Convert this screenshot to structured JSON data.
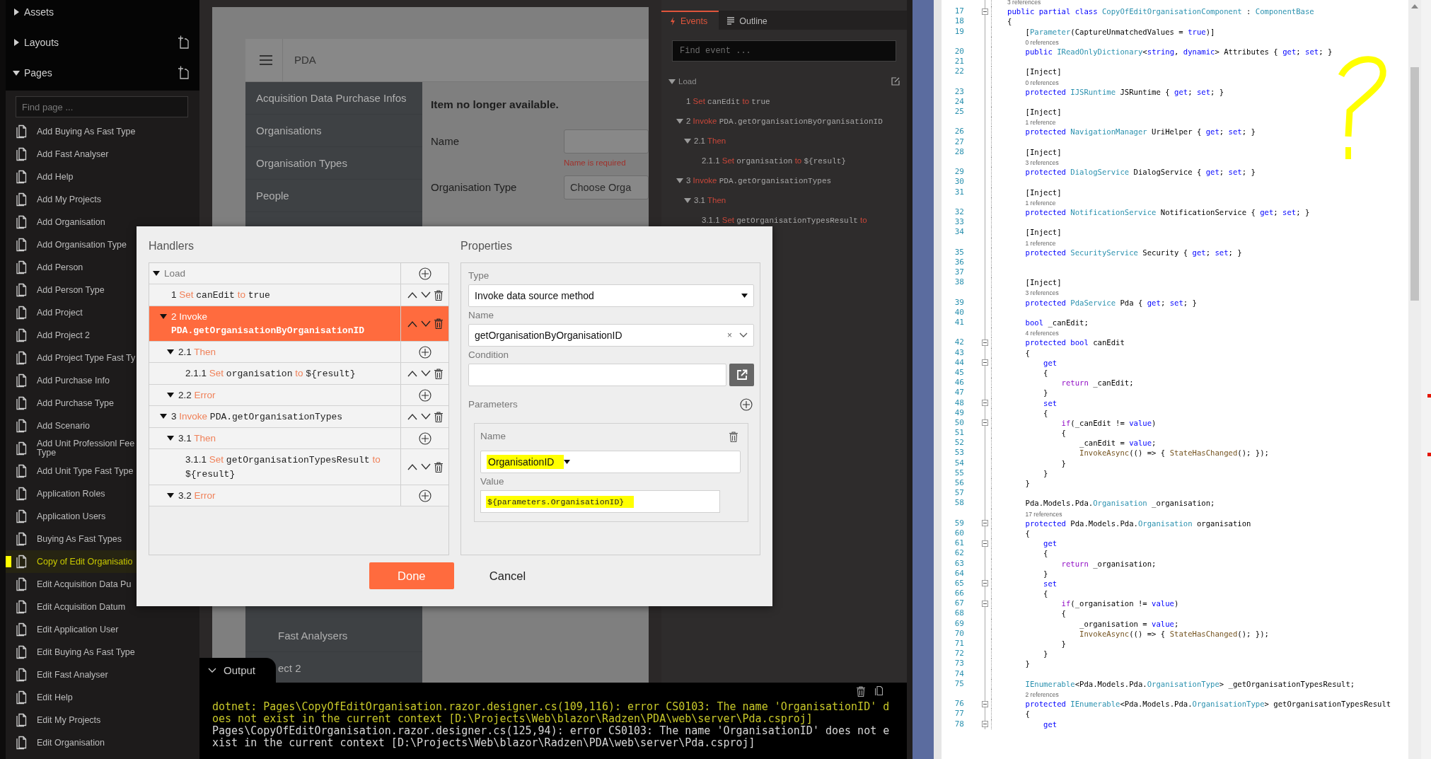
{
  "sidebar": {
    "sections": [
      {
        "label": "Assets",
        "expanded": false,
        "add_button": false
      },
      {
        "label": "Layouts",
        "expanded": false,
        "add_button": true
      },
      {
        "label": "Pages",
        "expanded": true,
        "add_button": true
      }
    ],
    "search": {
      "placeholder": "Find page ..."
    },
    "pages": [
      {
        "label": "Add Buying As Fast Type",
        "highlighted": false
      },
      {
        "label": "Add Fast Analyser",
        "highlighted": false
      },
      {
        "label": "Add Help",
        "highlighted": false
      },
      {
        "label": "Add My Projects",
        "highlighted": false
      },
      {
        "label": "Add Organisation",
        "highlighted": false
      },
      {
        "label": "Add Organisation Type",
        "highlighted": false
      },
      {
        "label": "Add Person",
        "highlighted": false
      },
      {
        "label": "Add Person Type",
        "highlighted": false
      },
      {
        "label": "Add Project",
        "highlighted": false
      },
      {
        "label": "Add Project 2",
        "highlighted": false
      },
      {
        "label": "Add Project Type Fast Ty",
        "highlighted": false
      },
      {
        "label": "Add Purchase Info",
        "highlighted": false
      },
      {
        "label": "Add Purchase Type",
        "highlighted": false
      },
      {
        "label": "Add Scenario",
        "highlighted": false
      },
      {
        "label": "Add Unit Professionl Fee Type",
        "highlighted": false
      },
      {
        "label": "Add Unit Type Fast Type",
        "highlighted": false
      },
      {
        "label": "Application Roles",
        "highlighted": false
      },
      {
        "label": "Application Users",
        "highlighted": false
      },
      {
        "label": "Buying As Fast Types",
        "highlighted": false
      },
      {
        "label": "Copy of Edit Organisatio",
        "highlighted": true
      },
      {
        "label": "Edit Acquisition Data Pu",
        "highlighted": false
      },
      {
        "label": "Edit Acquisition Datum",
        "highlighted": false
      },
      {
        "label": "Edit Application User",
        "highlighted": false
      },
      {
        "label": "Edit Buying As Fast Type",
        "highlighted": false
      },
      {
        "label": "Edit Fast Analyser",
        "highlighted": false
      },
      {
        "label": "Edit Help",
        "highlighted": false
      },
      {
        "label": "Edit My Projects",
        "highlighted": false
      },
      {
        "label": "Edit Organisation",
        "highlighted": false
      }
    ]
  },
  "designer": {
    "app_title": "PDA",
    "nav_items": [
      "Acquisition Data Purchase Infos",
      "Organisations",
      "Organisation Types",
      "People"
    ],
    "nav_items_lower": [
      "Fast Analysers",
      "ect 2"
    ],
    "form": {
      "notice": "Item no longer available.",
      "fields": [
        {
          "label": "Name",
          "kind": "text",
          "error": "Name is required"
        },
        {
          "label": "Organisation Type",
          "kind": "dropdown",
          "placeholder": "Choose Orga"
        }
      ]
    }
  },
  "events_panel": {
    "tabs": [
      {
        "label": "Events",
        "selected": true
      },
      {
        "label": "Outline",
        "selected": false
      }
    ],
    "search": {
      "placeholder": "Find event ..."
    },
    "tree": {
      "label": "Load",
      "expanded": true,
      "children": [
        {
          "number": "1",
          "verb": "Set",
          "target": "canEdit",
          "link": "to",
          "value": "true"
        },
        {
          "number": "2",
          "verb": "Invoke",
          "target": "PDA.getOrganisationByOrganisationID",
          "expanded": true,
          "children": [
            {
              "number": "2.1",
              "verb": "Then",
              "expanded": true,
              "children": [
                {
                  "number": "2.1.1",
                  "verb": "Set",
                  "target": "organisation",
                  "link": "to",
                  "value": "${result}"
                }
              ]
            }
          ]
        },
        {
          "number": "3",
          "verb": "Invoke",
          "target": "PDA.getOrganisationTypes",
          "expanded": true,
          "children": [
            {
              "number": "3.1",
              "verb": "Then",
              "expanded": true,
              "children": [
                {
                  "number": "3.1.1",
                  "verb": "Set",
                  "target": "getOrganisationTypesResult",
                  "link": "to"
                }
              ]
            }
          ]
        }
      ]
    }
  },
  "dialog": {
    "handlers_title": "Handlers",
    "properties_title": "Properties",
    "handlers": {
      "label": "Load",
      "kind": "group",
      "expanded": true,
      "selected": false,
      "children": [
        {
          "number": "1",
          "verb": "Set",
          "target": "canEdit",
          "link": "to",
          "value": "true",
          "kind": "action",
          "selected": false
        },
        {
          "number": "2",
          "verb": "Invoke",
          "target": "PDA.getOrganisationByOrganisationID",
          "kind": "action",
          "expanded": true,
          "selected": true,
          "children": [
            {
              "number": "2.1",
              "verb": "Then",
              "kind": "group",
              "expanded": true,
              "selected": false,
              "children": [
                {
                  "number": "2.1.1",
                  "verb": "Set",
                  "target": "organisation",
                  "link": "to",
                  "value": "${result}",
                  "kind": "action",
                  "selected": false
                }
              ]
            },
            {
              "number": "2.2",
              "verb": "Error",
              "kind": "group",
              "expanded": true,
              "selected": false
            }
          ]
        },
        {
          "number": "3",
          "verb": "Invoke",
          "target": "PDA.getOrganisationTypes",
          "kind": "action",
          "expanded": true,
          "selected": false,
          "children": [
            {
              "number": "3.1",
              "verb": "Then",
              "kind": "group",
              "expanded": true,
              "selected": false,
              "children": [
                {
                  "number": "3.1.1",
                  "verb": "Set",
                  "target": "getOrganisationTypesResult",
                  "link": "to",
                  "value": "${result}",
                  "kind": "action",
                  "selected": false
                }
              ]
            },
            {
              "number": "3.2",
              "verb": "Error",
              "kind": "group",
              "expanded": true,
              "selected": false
            }
          ]
        }
      ]
    },
    "properties": [
      {
        "label": "Type",
        "kind": "select",
        "value": "Invoke data source method"
      },
      {
        "label": "Name",
        "kind": "combo",
        "value": "getOrganisationByOrganisationID",
        "clear": "×"
      },
      {
        "label": "Condition",
        "kind": "expression"
      }
    ],
    "parameters": {
      "label": "Parameters",
      "items": [
        {
          "name_label": "Name",
          "name": "OrganisationID",
          "name_highlighted": true,
          "value_label": "Value",
          "value": "${parameters.OrganisationID}",
          "value_highlighted": true
        }
      ]
    },
    "buttons": [
      {
        "label": "Done",
        "kind": "primary"
      },
      {
        "label": "Cancel",
        "kind": "plain"
      }
    ]
  },
  "output": {
    "title": "Output",
    "messages": [
      {
        "kind": "highlight",
        "text": "dotnet: Pages\\CopyOfEditOrganisation.razor.designer.cs(109,116): error CS0103: The name 'OrganisationID' does not exist in the current context [D:\\Projects\\Web\\blazor\\Radzen\\PDA\\web\\server\\Pda.csproj]"
      },
      {
        "kind": "normal",
        "text": "Pages\\CopyOfEditOrganisation.razor.designer.cs(125,94): error CS0103: The name 'OrganisationID' does not exist in the current context [D:\\Projects\\Web\\blazor\\Radzen\\PDA\\web\\server\\Pda.csproj]"
      }
    ]
  },
  "code_editor": {
    "lines": [
      {
        "kind": "codelens",
        "text": "3 references"
      },
      {
        "kind": "code",
        "number": "17",
        "fold": true,
        "tokens": [
          {
            "kind": "keyword",
            "text": "public partial class "
          },
          {
            "kind": "type",
            "text": "CopyOfEditOrganisationComponent"
          },
          {
            "kind": "plain",
            "text": " : "
          },
          {
            "kind": "type",
            "text": "ComponentBase"
          }
        ]
      },
      {
        "kind": "code",
        "number": "18",
        "fold": false,
        "tokens": [
          {
            "kind": "plain",
            "text": "{"
          }
        ]
      },
      {
        "kind": "code",
        "number": "19",
        "fold": false,
        "tokens": [
          {
            "kind": "plain",
            "text": "    ["
          },
          {
            "kind": "type",
            "text": "Parameter"
          },
          {
            "kind": "plain",
            "text": "(CaptureUnmatchedValues = "
          },
          {
            "kind": "keyword",
            "text": "true"
          },
          {
            "kind": "plain",
            "text": ")]"
          }
        ]
      },
      {
        "kind": "codelens",
        "text": "    0 references"
      },
      {
        "kind": "code",
        "number": "20",
        "fold": false,
        "tokens": [
          {
            "kind": "keyword",
            "text": "    public "
          },
          {
            "kind": "type",
            "text": "IReadOnlyDictionary"
          },
          {
            "kind": "plain",
            "text": "<"
          },
          {
            "kind": "keyword",
            "text": "string"
          },
          {
            "kind": "plain",
            "text": ", "
          },
          {
            "kind": "keyword",
            "text": "dynamic"
          },
          {
            "kind": "plain",
            "text": "> Attributes { "
          },
          {
            "kind": "keyword",
            "text": "get"
          },
          {
            "kind": "plain",
            "text": "; "
          },
          {
            "kind": "keyword",
            "text": "set"
          },
          {
            "kind": "plain",
            "text": "; }"
          }
        ]
      },
      {
        "kind": "code",
        "number": "21",
        "fold": false
      },
      {
        "kind": "code",
        "number": "22",
        "fold": false,
        "tokens": [
          {
            "kind": "plain",
            "text": "    [Inject]"
          }
        ]
      },
      {
        "kind": "codelens",
        "text": "    0 references"
      },
      {
        "kind": "code",
        "number": "23",
        "fold": false,
        "tokens": [
          {
            "kind": "keyword",
            "text": "    protected "
          },
          {
            "kind": "type",
            "text": "IJSRuntime"
          },
          {
            "kind": "plain",
            "text": " JSRuntime { "
          },
          {
            "kind": "keyword",
            "text": "get"
          },
          {
            "kind": "plain",
            "text": "; "
          },
          {
            "kind": "keyword",
            "text": "set"
          },
          {
            "kind": "plain",
            "text": "; }"
          }
        ]
      },
      {
        "kind": "code",
        "number": "24",
        "fold": false
      },
      {
        "kind": "code",
        "number": "25",
        "fold": false,
        "tokens": [
          {
            "kind": "plain",
            "text": "    [Inject]"
          }
        ]
      },
      {
        "kind": "codelens",
        "text": "    1 reference"
      },
      {
        "kind": "code",
        "number": "26",
        "fold": false,
        "tokens": [
          {
            "kind": "keyword",
            "text": "    protected "
          },
          {
            "kind": "type",
            "text": "NavigationManager"
          },
          {
            "kind": "plain",
            "text": " UriHelper { "
          },
          {
            "kind": "keyword",
            "text": "get"
          },
          {
            "kind": "plain",
            "text": "; "
          },
          {
            "kind": "keyword",
            "text": "set"
          },
          {
            "kind": "plain",
            "text": "; }"
          }
        ]
      },
      {
        "kind": "code",
        "number": "27",
        "fold": false
      },
      {
        "kind": "code",
        "number": "28",
        "fold": false,
        "tokens": [
          {
            "kind": "plain",
            "text": "    [Inject]"
          }
        ]
      },
      {
        "kind": "codelens",
        "text": "    3 references"
      },
      {
        "kind": "code",
        "number": "29",
        "fold": false,
        "tokens": [
          {
            "kind": "keyword",
            "text": "    protected "
          },
          {
            "kind": "type",
            "text": "DialogService"
          },
          {
            "kind": "plain",
            "text": " DialogService { "
          },
          {
            "kind": "keyword",
            "text": "get"
          },
          {
            "kind": "plain",
            "text": "; "
          },
          {
            "kind": "keyword",
            "text": "set"
          },
          {
            "kind": "plain",
            "text": "; }"
          }
        ]
      },
      {
        "kind": "code",
        "number": "30",
        "fold": false
      },
      {
        "kind": "code",
        "number": "31",
        "fold": false,
        "tokens": [
          {
            "kind": "plain",
            "text": "    [Inject]"
          }
        ]
      },
      {
        "kind": "codelens",
        "text": "    1 reference"
      },
      {
        "kind": "code",
        "number": "32",
        "fold": false,
        "tokens": [
          {
            "kind": "keyword",
            "text": "    protected "
          },
          {
            "kind": "type",
            "text": "NotificationService"
          },
          {
            "kind": "plain",
            "text": " NotificationService { "
          },
          {
            "kind": "keyword",
            "text": "get"
          },
          {
            "kind": "plain",
            "text": "; "
          },
          {
            "kind": "keyword",
            "text": "set"
          },
          {
            "kind": "plain",
            "text": "; }"
          }
        ]
      },
      {
        "kind": "code",
        "number": "33",
        "fold": false
      },
      {
        "kind": "code",
        "number": "34",
        "fold": false,
        "tokens": [
          {
            "kind": "plain",
            "text": "    [Inject]"
          }
        ]
      },
      {
        "kind": "codelens",
        "text": "    1 reference"
      },
      {
        "kind": "code",
        "number": "35",
        "fold": false,
        "tokens": [
          {
            "kind": "keyword",
            "text": "    protected "
          },
          {
            "kind": "type",
            "text": "SecurityService"
          },
          {
            "kind": "plain",
            "text": " Security { "
          },
          {
            "kind": "keyword",
            "text": "get"
          },
          {
            "kind": "plain",
            "text": "; "
          },
          {
            "kind": "keyword",
            "text": "set"
          },
          {
            "kind": "plain",
            "text": "; }"
          }
        ]
      },
      {
        "kind": "code",
        "number": "36",
        "fold": false
      },
      {
        "kind": "code",
        "number": "37",
        "fold": false
      },
      {
        "kind": "code",
        "number": "38",
        "fold": false,
        "tokens": [
          {
            "kind": "plain",
            "text": "    [Inject]"
          }
        ]
      },
      {
        "kind": "codelens",
        "text": "    3 references"
      },
      {
        "kind": "code",
        "number": "39",
        "fold": false,
        "tokens": [
          {
            "kind": "keyword",
            "text": "    protected "
          },
          {
            "kind": "type",
            "text": "PdaService"
          },
          {
            "kind": "plain",
            "text": " Pda { "
          },
          {
            "kind": "keyword",
            "text": "get"
          },
          {
            "kind": "plain",
            "text": "; "
          },
          {
            "kind": "keyword",
            "text": "set"
          },
          {
            "kind": "plain",
            "text": "; }"
          }
        ]
      },
      {
        "kind": "code",
        "number": "40",
        "fold": false
      },
      {
        "kind": "code",
        "number": "41",
        "fold": false,
        "tokens": [
          {
            "kind": "keyword",
            "text": "    bool"
          },
          {
            "kind": "plain",
            "text": " _canEdit;"
          }
        ]
      },
      {
        "kind": "codelens",
        "text": "    4 references"
      },
      {
        "kind": "code",
        "number": "42",
        "fold": true,
        "tokens": [
          {
            "kind": "keyword",
            "text": "    protected bool"
          },
          {
            "kind": "plain",
            "text": " canEdit"
          }
        ]
      },
      {
        "kind": "code",
        "number": "43",
        "fold": false,
        "tokens": [
          {
            "kind": "plain",
            "text": "    {"
          }
        ]
      },
      {
        "kind": "code",
        "number": "44",
        "fold": true,
        "tokens": [
          {
            "kind": "keyword",
            "text": "        get"
          }
        ]
      },
      {
        "kind": "code",
        "number": "45",
        "fold": false,
        "tokens": [
          {
            "kind": "plain",
            "text": "        {"
          }
        ]
      },
      {
        "kind": "code",
        "number": "46",
        "fold": false,
        "tokens": [
          {
            "kind": "control",
            "text": "            return"
          },
          {
            "kind": "plain",
            "text": " _canEdit;"
          }
        ]
      },
      {
        "kind": "code",
        "number": "47",
        "fold": false,
        "tokens": [
          {
            "kind": "plain",
            "text": "        }"
          }
        ]
      },
      {
        "kind": "code",
        "number": "48",
        "fold": true,
        "tokens": [
          {
            "kind": "keyword",
            "text": "        set"
          }
        ]
      },
      {
        "kind": "code",
        "number": "49",
        "fold": false,
        "tokens": [
          {
            "kind": "plain",
            "text": "        {"
          }
        ]
      },
      {
        "kind": "code",
        "number": "50",
        "fold": true,
        "tokens": [
          {
            "kind": "control",
            "text": "            if"
          },
          {
            "kind": "plain",
            "text": "(_canEdit != "
          },
          {
            "kind": "keyword",
            "text": "value"
          },
          {
            "kind": "plain",
            "text": ")"
          }
        ]
      },
      {
        "kind": "code",
        "number": "51",
        "fold": false,
        "tokens": [
          {
            "kind": "plain",
            "text": "            {"
          }
        ]
      },
      {
        "kind": "code",
        "number": "52",
        "fold": false,
        "tokens": [
          {
            "kind": "plain",
            "text": "                _canEdit = "
          },
          {
            "kind": "keyword",
            "text": "value"
          },
          {
            "kind": "plain",
            "text": ";"
          }
        ]
      },
      {
        "kind": "code",
        "number": "53",
        "fold": false,
        "tokens": [
          {
            "kind": "method",
            "text": "                InvokeAsync"
          },
          {
            "kind": "plain",
            "text": "(() => { "
          },
          {
            "kind": "method",
            "text": "StateHasChanged"
          },
          {
            "kind": "plain",
            "text": "(); });"
          }
        ]
      },
      {
        "kind": "code",
        "number": "54",
        "fold": false,
        "tokens": [
          {
            "kind": "plain",
            "text": "            }"
          }
        ]
      },
      {
        "kind": "code",
        "number": "55",
        "fold": false,
        "tokens": [
          {
            "kind": "plain",
            "text": "        }"
          }
        ]
      },
      {
        "kind": "code",
        "number": "56",
        "fold": false,
        "tokens": [
          {
            "kind": "plain",
            "text": "    }"
          }
        ]
      },
      {
        "kind": "code",
        "number": "57",
        "fold": false
      },
      {
        "kind": "code",
        "number": "58",
        "fold": false,
        "tokens": [
          {
            "kind": "plain",
            "text": "    Pda.Models.Pda."
          },
          {
            "kind": "type",
            "text": "Organisation"
          },
          {
            "kind": "plain",
            "text": " _organisation;"
          }
        ]
      },
      {
        "kind": "codelens",
        "text": "    17 references"
      },
      {
        "kind": "code",
        "number": "59",
        "fold": true,
        "tokens": [
          {
            "kind": "keyword",
            "text": "    protected"
          },
          {
            "kind": "plain",
            "text": " Pda.Models.Pda."
          },
          {
            "kind": "type",
            "text": "Organisation"
          },
          {
            "kind": "plain",
            "text": " organisation"
          }
        ]
      },
      {
        "kind": "code",
        "number": "60",
        "fold": false,
        "tokens": [
          {
            "kind": "plain",
            "text": "    {"
          }
        ]
      },
      {
        "kind": "code",
        "number": "61",
        "fold": true,
        "tokens": [
          {
            "kind": "keyword",
            "text": "        get"
          }
        ]
      },
      {
        "kind": "code",
        "number": "62",
        "fold": false,
        "tokens": [
          {
            "kind": "plain",
            "text": "        {"
          }
        ]
      },
      {
        "kind": "code",
        "number": "63",
        "fold": false,
        "tokens": [
          {
            "kind": "control",
            "text": "            return"
          },
          {
            "kind": "plain",
            "text": " _organisation;"
          }
        ]
      },
      {
        "kind": "code",
        "number": "64",
        "fold": false,
        "tokens": [
          {
            "kind": "plain",
            "text": "        }"
          }
        ]
      },
      {
        "kind": "code",
        "number": "65",
        "fold": true,
        "tokens": [
          {
            "kind": "keyword",
            "text": "        set"
          }
        ]
      },
      {
        "kind": "code",
        "number": "66",
        "fold": false,
        "tokens": [
          {
            "kind": "plain",
            "text": "        {"
          }
        ]
      },
      {
        "kind": "code",
        "number": "67",
        "fold": true,
        "tokens": [
          {
            "kind": "control",
            "text": "            if"
          },
          {
            "kind": "plain",
            "text": "(_organisation != "
          },
          {
            "kind": "keyword",
            "text": "value"
          },
          {
            "kind": "plain",
            "text": ")"
          }
        ]
      },
      {
        "kind": "code",
        "number": "68",
        "fold": false,
        "tokens": [
          {
            "kind": "plain",
            "text": "            {"
          }
        ]
      },
      {
        "kind": "code",
        "number": "69",
        "fold": false,
        "tokens": [
          {
            "kind": "plain",
            "text": "                _organisation = "
          },
          {
            "kind": "keyword",
            "text": "value"
          },
          {
            "kind": "plain",
            "text": ";"
          }
        ]
      },
      {
        "kind": "code",
        "number": "70",
        "fold": false,
        "tokens": [
          {
            "kind": "method",
            "text": "                InvokeAsync"
          },
          {
            "kind": "plain",
            "text": "(() => { "
          },
          {
            "kind": "method",
            "text": "StateHasChanged"
          },
          {
            "kind": "plain",
            "text": "(); });"
          }
        ]
      },
      {
        "kind": "code",
        "number": "71",
        "fold": false,
        "tokens": [
          {
            "kind": "plain",
            "text": "            }"
          }
        ]
      },
      {
        "kind": "code",
        "number": "72",
        "fold": false,
        "tokens": [
          {
            "kind": "plain",
            "text": "        }"
          }
        ]
      },
      {
        "kind": "code",
        "number": "73",
        "fold": false,
        "tokens": [
          {
            "kind": "plain",
            "text": "    }"
          }
        ]
      },
      {
        "kind": "code",
        "number": "74",
        "fold": false
      },
      {
        "kind": "code",
        "number": "75",
        "fold": false,
        "tokens": [
          {
            "kind": "type",
            "text": "    IEnumerable"
          },
          {
            "kind": "plain",
            "text": "<Pda.Models.Pda."
          },
          {
            "kind": "type",
            "text": "OrganisationType"
          },
          {
            "kind": "plain",
            "text": "> _getOrganisationTypesResult;"
          }
        ]
      },
      {
        "kind": "codelens",
        "text": "    2 references"
      },
      {
        "kind": "code",
        "number": "76",
        "fold": true,
        "tokens": [
          {
            "kind": "keyword",
            "text": "    protected "
          },
          {
            "kind": "type",
            "text": "IEnumerable"
          },
          {
            "kind": "plain",
            "text": "<Pda.Models.Pda."
          },
          {
            "kind": "type",
            "text": "OrganisationType"
          },
          {
            "kind": "plain",
            "text": "> getOrganisationTypesResult"
          }
        ]
      },
      {
        "kind": "code",
        "number": "77",
        "fold": false,
        "tokens": [
          {
            "kind": "plain",
            "text": "    {"
          }
        ]
      },
      {
        "kind": "code",
        "number": "78",
        "fold": true,
        "tokens": [
          {
            "kind": "keyword",
            "text": "        get"
          }
        ]
      }
    ]
  }
}
